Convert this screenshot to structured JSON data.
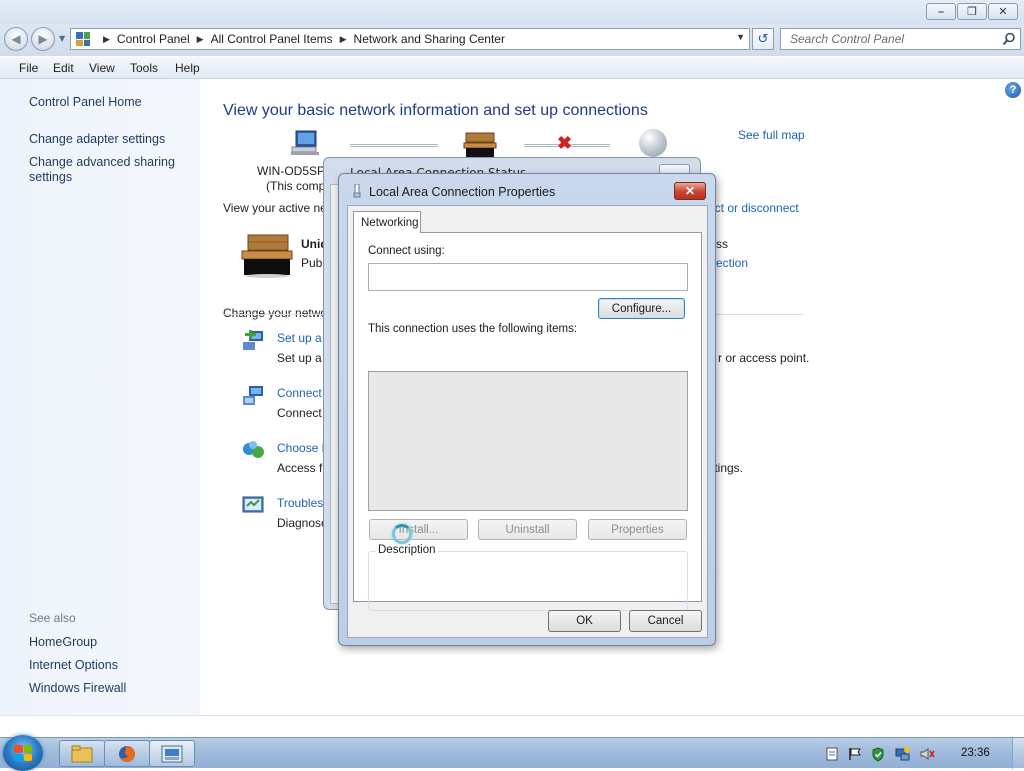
{
  "breadcrumb": [
    "Control Panel",
    "All Control Panel Items",
    "Network and Sharing Center"
  ],
  "search": {
    "placeholder": "Search Control Panel"
  },
  "menu": [
    "File",
    "Edit",
    "View",
    "Tools",
    "Help"
  ],
  "sidebar": {
    "home": "Control Panel Home",
    "links": [
      "Change adapter settings",
      "Change advanced sharing settings"
    ],
    "see_also_label": "See also",
    "see_also": [
      "HomeGroup",
      "Internet Options",
      "Windows Firewall"
    ]
  },
  "main": {
    "title": "View your basic network information and set up connections",
    "see_full_map": "See full map",
    "computer_name": "WIN-OD5SP",
    "this_computer": "(This comp",
    "active_networks": "View your active ne",
    "connect_disconnect": "ect or disconnect",
    "network_name": "Unid",
    "network_type": "Pub",
    "access_type": "ss",
    "connection_link": "ection",
    "change_settings": "Change your netwo",
    "tasks": [
      {
        "link": "Set up a",
        "desc": "Set up a",
        "desc_tail": "r or access point."
      },
      {
        "link": "Connect",
        "desc": "Connect",
        "desc_tail": ""
      },
      {
        "link": "Choose h",
        "desc": "Access fi",
        "desc_tail": "ttings."
      },
      {
        "link": "Troubles",
        "desc": "Diagnose",
        "desc_tail": ""
      }
    ]
  },
  "status_window": {
    "title": "Local Area Connection Status"
  },
  "dialog": {
    "title": "Local Area Connection Properties",
    "tab": "Networking",
    "connect_using_label": "Connect using:",
    "connect_using_value": "",
    "configure_button": "Configure...",
    "items_label": "This connection uses the following items:",
    "install_button": "Install...",
    "uninstall_button": "Uninstall",
    "properties_button": "Properties",
    "description_label": "Description",
    "ok_button": "OK",
    "cancel_button": "Cancel"
  },
  "taskbar": {
    "clock": "23:36"
  },
  "colors": {
    "link": "#1b63b5",
    "title": "#1e3a8a",
    "sidebar_bg": "#eef4fb",
    "close_red": "#c8442e"
  }
}
